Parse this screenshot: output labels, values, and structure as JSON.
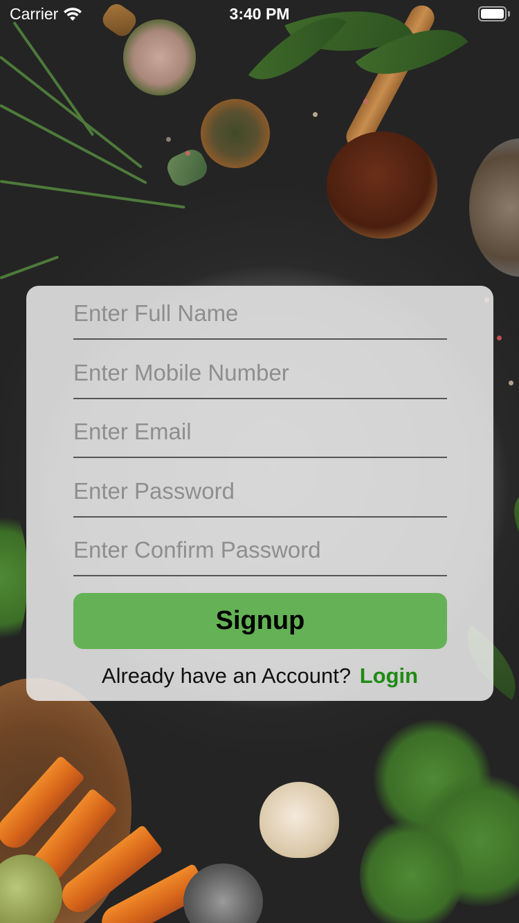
{
  "status_bar": {
    "carrier": "Carrier",
    "time": "3:40 PM"
  },
  "signup_form": {
    "full_name_placeholder": "Enter Full Name",
    "mobile_placeholder": "Enter Mobile Number",
    "email_placeholder": "Enter Email",
    "password_placeholder": "Enter Password",
    "confirm_password_placeholder": "Enter Confirm Password",
    "signup_label": "Signup",
    "login_prompt": "Already have an Account?",
    "login_label": "Login"
  },
  "colors": {
    "signup_button": "#64b255",
    "login_link": "#1f8a14",
    "card_background": "#ececec"
  },
  "icons": [
    "wifi-icon",
    "battery-icon"
  ]
}
